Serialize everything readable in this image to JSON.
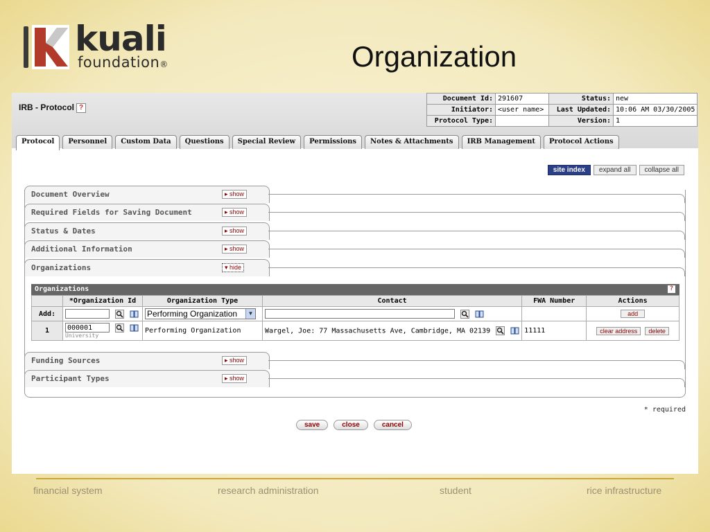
{
  "slide": {
    "logo_word": "kuali",
    "logo_sub": "foundation",
    "logo_reg": "®",
    "title": "Organization"
  },
  "doc": {
    "title": "IRB - Protocol",
    "help_icon": "question-icon",
    "info": {
      "doc_id_label": "Document Id:",
      "doc_id": "291607",
      "status_label": "Status:",
      "status": "new",
      "initiator_label": "Initiator:",
      "initiator": "<user name>",
      "last_updated_label": "Last Updated:",
      "last_updated": "10:06 AM 03/30/2005",
      "protocol_type_label": "Protocol Type:",
      "protocol_type": "",
      "version_label": "Version:",
      "version": "1"
    }
  },
  "tabs": [
    "Protocol",
    "Personnel",
    "Custom Data",
    "Questions",
    "Special Review",
    "Permissions",
    "Notes & Attachments",
    "IRB Management",
    "Protocol Actions"
  ],
  "toolbar": {
    "site_index": "site index",
    "expand_all": "expand all",
    "collapse_all": "collapse all"
  },
  "sections": [
    {
      "label": "Document Overview",
      "toggle": "show"
    },
    {
      "label": "Required Fields for Saving Document",
      "toggle": "show"
    },
    {
      "label": "Status & Dates",
      "toggle": "show"
    },
    {
      "label": "Additional Information",
      "toggle": "show"
    },
    {
      "label": "Organizations",
      "toggle": "hide"
    },
    {
      "label": "Funding Sources",
      "toggle": "show"
    },
    {
      "label": "Participant Types",
      "toggle": "show"
    }
  ],
  "org_table": {
    "title": "Organizations",
    "columns": [
      "*Organization Id",
      "Organization Type",
      "Contact",
      "FWA Number",
      "Actions"
    ],
    "add_row": {
      "label": "Add:",
      "org_id": "",
      "org_type": "Performing Organization",
      "contact": "",
      "fwa": "",
      "action": "add"
    },
    "rows": [
      {
        "num": "1",
        "org_id": "000001",
        "org_sub": "University",
        "org_type": "Performing Organization",
        "contact": "Wargel, Joe: 77 Massachusetts Ave, Cambridge, MA 02139",
        "fwa": "11111",
        "action1": "clear address",
        "action2": "delete"
      }
    ]
  },
  "required_note": "* required",
  "buttons": {
    "save": "save",
    "close": "close",
    "cancel": "cancel"
  },
  "footer": [
    "financial system",
    "research administration",
    "student",
    "rice infrastructure"
  ]
}
